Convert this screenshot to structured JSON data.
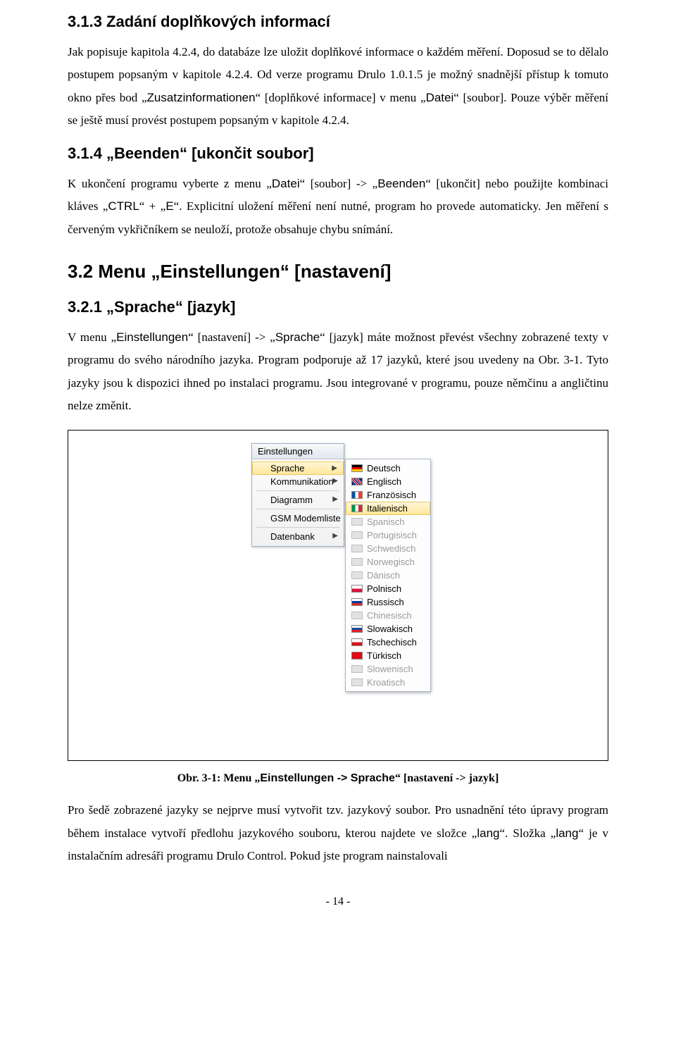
{
  "h313": "3.1.3 Zadání doplňkových informací",
  "p313_a": "Jak popisuje kapitola 4.2.4, do databáze lze uložit doplňkové informace o každém měření. Doposud se to dělalo postupem popsaným v kapitole 4.2.4. Od verze programu Drulo 1.0.1.5 je možný snadnější přístup k tomuto okno přes bod „",
  "p313_b": "“ [doplňkové informace] v menu „",
  "p313_c": "“ [soubor]. Pouze výběr měření se ještě musí provést postupem popsaným v kapitole 4.2.4.",
  "zusatz": "Zusatzinformationen",
  "datei": "Datei",
  "h314": "3.1.4 „Beenden“ [ukončit soubor]",
  "p314_a": "K ukončení programu vyberte z menu „",
  "p314_b": "“ [soubor] -> „",
  "p314_c": "“ [ukončit] nebo použijte kombinaci kláves „",
  "p314_d": "“ + „",
  "p314_e": "“. Explicitní uložení měření není nutné, program ho provede automaticky. Jen měření s červeným vykřičníkem se neuloží, protože obsahuje chybu snímání.",
  "beenden": "Beenden",
  "ctrl": "CTRL",
  "keyE": "E",
  "h32": "3.2 Menu „Einstellungen“ [nastavení]",
  "h321": "3.2.1 „Sprache“ [jazyk]",
  "p321_a": "V menu „",
  "p321_b": "“ [nastavení] -> „",
  "p321_c": "“ [jazyk] máte možnost převést všechny zobrazené texty v programu do svého národního jazyka. Program podporuje až 17 jazyků, které jsou uvedeny na Obr. 3-1. Tyto jazyky jsou k dispozici ihned po instalaci programu. Jsou integrované v programu, pouze němčinu a angličtinu nelze změnit.",
  "einstellungen": "Einstellungen",
  "sprache": "Sprache",
  "menu": {
    "title": "Einstellungen",
    "items": [
      "Sprache",
      "Kommunikation",
      "Diagramm",
      "GSM Modemliste",
      "Datenbank"
    ]
  },
  "languages": [
    {
      "label": "Deutsch",
      "enabled": true,
      "flag_bg": "linear-gradient(#000 0 33%,#d00 33% 66%,#fc0 66% 100%)"
    },
    {
      "label": "Englisch",
      "enabled": true,
      "flag_bg": "linear-gradient(45deg,#00247d 25%,#fff 25% 30%,#cf142b 30% 40%,#fff 40% 45%,#00247d 45% 55%,#fff 55% 60%,#cf142b 60% 70%,#fff 70% 75%,#00247d 75%)"
    },
    {
      "label": "Französisch",
      "enabled": true,
      "flag_bg": "linear-gradient(90deg,#0055a4 0 33%,#fff 33% 66%,#ef4135 66% 100%)"
    },
    {
      "label": "Italienisch",
      "enabled": true,
      "flag_bg": "linear-gradient(90deg,#009246 0 33%,#fff 33% 66%,#ce2b37 66% 100%)",
      "hover": true
    },
    {
      "label": "Spanisch",
      "enabled": false,
      "flag_bg": "#ccc"
    },
    {
      "label": "Portugisisch",
      "enabled": false,
      "flag_bg": "#ccc"
    },
    {
      "label": "Schwedisch",
      "enabled": false,
      "flag_bg": "#ccc"
    },
    {
      "label": "Norwegisch",
      "enabled": false,
      "flag_bg": "#ccc"
    },
    {
      "label": "Dänisch",
      "enabled": false,
      "flag_bg": "#ccc"
    },
    {
      "label": "Polnisch",
      "enabled": true,
      "flag_bg": "linear-gradient(#fff 0 50%,#dc143c 50% 100%)"
    },
    {
      "label": "Russisch",
      "enabled": true,
      "flag_bg": "linear-gradient(#fff 0 33%,#0039a6 33% 66%,#d52b1e 66% 100%)"
    },
    {
      "label": "Chinesisch",
      "enabled": false,
      "flag_bg": "#ccc"
    },
    {
      "label": "Slowakisch",
      "enabled": true,
      "flag_bg": "linear-gradient(#fff 0 33%,#0b4ea2 33% 66%,#ee1c25 66% 100%)"
    },
    {
      "label": "Tschechisch",
      "enabled": true,
      "flag_bg": "linear-gradient(#fff 0 50%,#d7141a 50% 100%)"
    },
    {
      "label": "Türkisch",
      "enabled": true,
      "flag_bg": "#e30a17"
    },
    {
      "label": "Slowenisch",
      "enabled": false,
      "flag_bg": "#ccc"
    },
    {
      "label": "Kroatisch",
      "enabled": false,
      "flag_bg": "#ccc"
    }
  ],
  "caption_a": "Obr. 3-1: Menu „",
  "caption_b": "Einstellungen -> Sprache",
  "caption_c": "“ [nastavení -> jazyk]",
  "pfinal_a": "Pro šedě zobrazené jazyky se nejprve musí vytvořit tzv. jazykový soubor. Pro usnadnění této úpravy program během instalace vytvoří předlohu jazykového souboru, kterou najdete ve složce „",
  "pfinal_b": "“. Složka „",
  "pfinal_c": "“ je v instalačním adresáři programu Drulo Control. Pokud jste program nainstalovali",
  "lang_dir": "lang",
  "page_number": "- 14 -"
}
